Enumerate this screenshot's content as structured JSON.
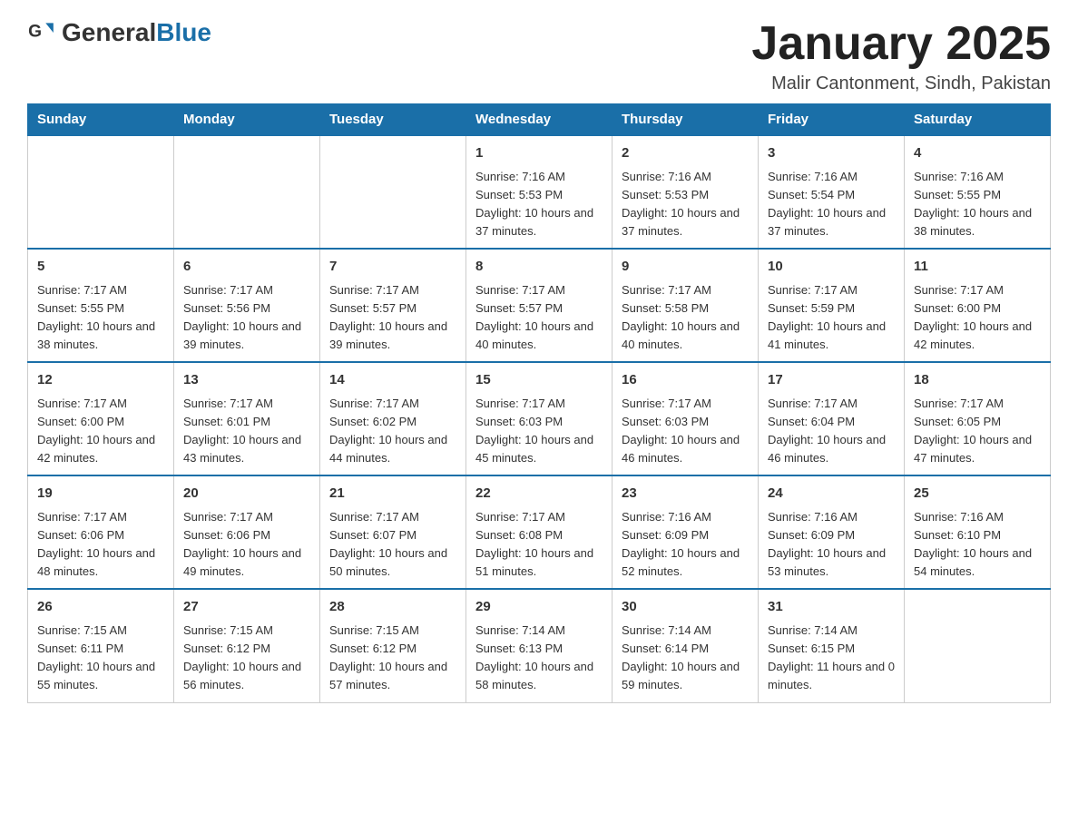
{
  "header": {
    "logo_general": "General",
    "logo_blue": "Blue",
    "month_title": "January 2025",
    "location": "Malir Cantonment, Sindh, Pakistan"
  },
  "weekdays": [
    "Sunday",
    "Monday",
    "Tuesday",
    "Wednesday",
    "Thursday",
    "Friday",
    "Saturday"
  ],
  "weeks": [
    [
      {
        "day": "",
        "sunrise": "",
        "sunset": "",
        "daylight": ""
      },
      {
        "day": "",
        "sunrise": "",
        "sunset": "",
        "daylight": ""
      },
      {
        "day": "",
        "sunrise": "",
        "sunset": "",
        "daylight": ""
      },
      {
        "day": "1",
        "sunrise": "Sunrise: 7:16 AM",
        "sunset": "Sunset: 5:53 PM",
        "daylight": "Daylight: 10 hours and 37 minutes."
      },
      {
        "day": "2",
        "sunrise": "Sunrise: 7:16 AM",
        "sunset": "Sunset: 5:53 PM",
        "daylight": "Daylight: 10 hours and 37 minutes."
      },
      {
        "day": "3",
        "sunrise": "Sunrise: 7:16 AM",
        "sunset": "Sunset: 5:54 PM",
        "daylight": "Daylight: 10 hours and 37 minutes."
      },
      {
        "day": "4",
        "sunrise": "Sunrise: 7:16 AM",
        "sunset": "Sunset: 5:55 PM",
        "daylight": "Daylight: 10 hours and 38 minutes."
      }
    ],
    [
      {
        "day": "5",
        "sunrise": "Sunrise: 7:17 AM",
        "sunset": "Sunset: 5:55 PM",
        "daylight": "Daylight: 10 hours and 38 minutes."
      },
      {
        "day": "6",
        "sunrise": "Sunrise: 7:17 AM",
        "sunset": "Sunset: 5:56 PM",
        "daylight": "Daylight: 10 hours and 39 minutes."
      },
      {
        "day": "7",
        "sunrise": "Sunrise: 7:17 AM",
        "sunset": "Sunset: 5:57 PM",
        "daylight": "Daylight: 10 hours and 39 minutes."
      },
      {
        "day": "8",
        "sunrise": "Sunrise: 7:17 AM",
        "sunset": "Sunset: 5:57 PM",
        "daylight": "Daylight: 10 hours and 40 minutes."
      },
      {
        "day": "9",
        "sunrise": "Sunrise: 7:17 AM",
        "sunset": "Sunset: 5:58 PM",
        "daylight": "Daylight: 10 hours and 40 minutes."
      },
      {
        "day": "10",
        "sunrise": "Sunrise: 7:17 AM",
        "sunset": "Sunset: 5:59 PM",
        "daylight": "Daylight: 10 hours and 41 minutes."
      },
      {
        "day": "11",
        "sunrise": "Sunrise: 7:17 AM",
        "sunset": "Sunset: 6:00 PM",
        "daylight": "Daylight: 10 hours and 42 minutes."
      }
    ],
    [
      {
        "day": "12",
        "sunrise": "Sunrise: 7:17 AM",
        "sunset": "Sunset: 6:00 PM",
        "daylight": "Daylight: 10 hours and 42 minutes."
      },
      {
        "day": "13",
        "sunrise": "Sunrise: 7:17 AM",
        "sunset": "Sunset: 6:01 PM",
        "daylight": "Daylight: 10 hours and 43 minutes."
      },
      {
        "day": "14",
        "sunrise": "Sunrise: 7:17 AM",
        "sunset": "Sunset: 6:02 PM",
        "daylight": "Daylight: 10 hours and 44 minutes."
      },
      {
        "day": "15",
        "sunrise": "Sunrise: 7:17 AM",
        "sunset": "Sunset: 6:03 PM",
        "daylight": "Daylight: 10 hours and 45 minutes."
      },
      {
        "day": "16",
        "sunrise": "Sunrise: 7:17 AM",
        "sunset": "Sunset: 6:03 PM",
        "daylight": "Daylight: 10 hours and 46 minutes."
      },
      {
        "day": "17",
        "sunrise": "Sunrise: 7:17 AM",
        "sunset": "Sunset: 6:04 PM",
        "daylight": "Daylight: 10 hours and 46 minutes."
      },
      {
        "day": "18",
        "sunrise": "Sunrise: 7:17 AM",
        "sunset": "Sunset: 6:05 PM",
        "daylight": "Daylight: 10 hours and 47 minutes."
      }
    ],
    [
      {
        "day": "19",
        "sunrise": "Sunrise: 7:17 AM",
        "sunset": "Sunset: 6:06 PM",
        "daylight": "Daylight: 10 hours and 48 minutes."
      },
      {
        "day": "20",
        "sunrise": "Sunrise: 7:17 AM",
        "sunset": "Sunset: 6:06 PM",
        "daylight": "Daylight: 10 hours and 49 minutes."
      },
      {
        "day": "21",
        "sunrise": "Sunrise: 7:17 AM",
        "sunset": "Sunset: 6:07 PM",
        "daylight": "Daylight: 10 hours and 50 minutes."
      },
      {
        "day": "22",
        "sunrise": "Sunrise: 7:17 AM",
        "sunset": "Sunset: 6:08 PM",
        "daylight": "Daylight: 10 hours and 51 minutes."
      },
      {
        "day": "23",
        "sunrise": "Sunrise: 7:16 AM",
        "sunset": "Sunset: 6:09 PM",
        "daylight": "Daylight: 10 hours and 52 minutes."
      },
      {
        "day": "24",
        "sunrise": "Sunrise: 7:16 AM",
        "sunset": "Sunset: 6:09 PM",
        "daylight": "Daylight: 10 hours and 53 minutes."
      },
      {
        "day": "25",
        "sunrise": "Sunrise: 7:16 AM",
        "sunset": "Sunset: 6:10 PM",
        "daylight": "Daylight: 10 hours and 54 minutes."
      }
    ],
    [
      {
        "day": "26",
        "sunrise": "Sunrise: 7:15 AM",
        "sunset": "Sunset: 6:11 PM",
        "daylight": "Daylight: 10 hours and 55 minutes."
      },
      {
        "day": "27",
        "sunrise": "Sunrise: 7:15 AM",
        "sunset": "Sunset: 6:12 PM",
        "daylight": "Daylight: 10 hours and 56 minutes."
      },
      {
        "day": "28",
        "sunrise": "Sunrise: 7:15 AM",
        "sunset": "Sunset: 6:12 PM",
        "daylight": "Daylight: 10 hours and 57 minutes."
      },
      {
        "day": "29",
        "sunrise": "Sunrise: 7:14 AM",
        "sunset": "Sunset: 6:13 PM",
        "daylight": "Daylight: 10 hours and 58 minutes."
      },
      {
        "day": "30",
        "sunrise": "Sunrise: 7:14 AM",
        "sunset": "Sunset: 6:14 PM",
        "daylight": "Daylight: 10 hours and 59 minutes."
      },
      {
        "day": "31",
        "sunrise": "Sunrise: 7:14 AM",
        "sunset": "Sunset: 6:15 PM",
        "daylight": "Daylight: 11 hours and 0 minutes."
      },
      {
        "day": "",
        "sunrise": "",
        "sunset": "",
        "daylight": ""
      }
    ]
  ]
}
